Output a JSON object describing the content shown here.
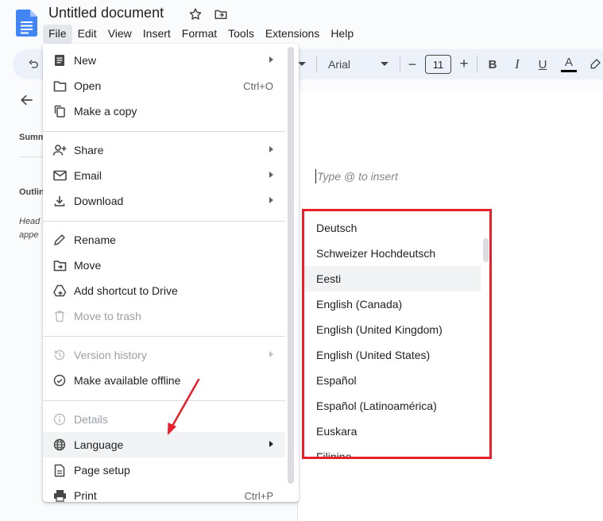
{
  "document": {
    "title": "Untitled document",
    "placeholder": "Type @ to insert"
  },
  "menubar": {
    "items": [
      "File",
      "Edit",
      "View",
      "Insert",
      "Format",
      "Tools",
      "Extensions",
      "Help"
    ]
  },
  "toolbar": {
    "font": "Arial",
    "font_size": "11",
    "minus": "−",
    "plus": "+",
    "bold": "B",
    "italic": "I",
    "underline": "U",
    "text_color": "A"
  },
  "outline_panel": {
    "summary_label": "Summ",
    "outline_label": "Outlin",
    "headings_line1": "Head",
    "headings_line2": "appe"
  },
  "file_menu": {
    "items": [
      {
        "label": "New",
        "icon": "doc-icon",
        "submenu": true
      },
      {
        "label": "Open",
        "icon": "folder-icon",
        "shortcut": "Ctrl+O"
      },
      {
        "label": "Make a copy",
        "icon": "copy-icon"
      },
      {
        "label": "Share",
        "icon": "person-add-icon",
        "submenu": true
      },
      {
        "label": "Email",
        "icon": "mail-icon",
        "submenu": true
      },
      {
        "label": "Download",
        "icon": "download-icon",
        "submenu": true
      },
      {
        "label": "Rename",
        "icon": "pencil-icon"
      },
      {
        "label": "Move",
        "icon": "folder-move-icon"
      },
      {
        "label": "Add shortcut to Drive",
        "icon": "drive-shortcut-icon"
      },
      {
        "label": "Move to trash",
        "icon": "trash-icon",
        "disabled": true
      },
      {
        "label": "Version history",
        "icon": "history-icon",
        "submenu": true,
        "disabled": true
      },
      {
        "label": "Make available offline",
        "icon": "offline-check-icon"
      },
      {
        "label": "Details",
        "icon": "info-icon",
        "disabled": true
      },
      {
        "label": "Language",
        "icon": "globe-icon",
        "submenu": true,
        "highlighted": true
      },
      {
        "label": "Page setup",
        "icon": "page-icon"
      },
      {
        "label": "Print",
        "icon": "printer-icon",
        "shortcut": "Ctrl+P"
      }
    ]
  },
  "language_menu": {
    "items": [
      "Deutsch",
      "Schweizer Hochdeutsch",
      "Eesti",
      "English (Canada)",
      "English (United Kingdom)",
      "English (United States)",
      "Español",
      "Español (Latinoamérica)",
      "Euskara",
      "Filipino"
    ],
    "highlighted": "Eesti"
  },
  "colors": {
    "annotation_red": "#e8202a",
    "docs_blue": "#4285f4",
    "menu_highlight": "#f1f3f4"
  }
}
